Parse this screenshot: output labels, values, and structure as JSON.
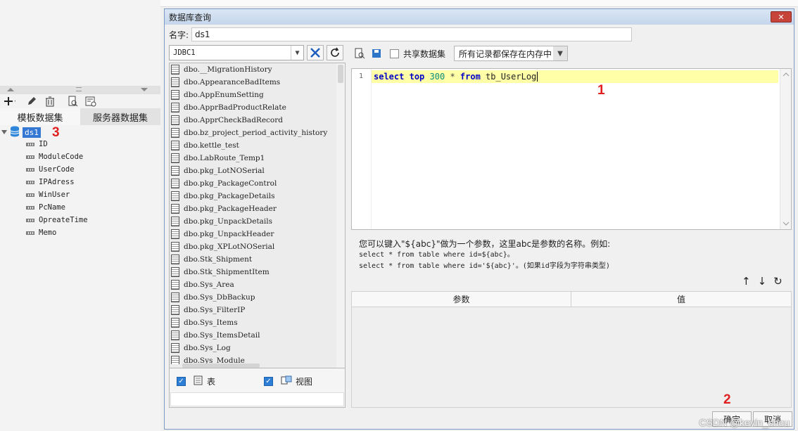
{
  "left_panel": {
    "tabs": [
      "模板数据集",
      "服务器数据集"
    ],
    "dataset": {
      "name": "ds1",
      "marker": "3"
    },
    "fields": [
      "ID",
      "ModuleCode",
      "UserCode",
      "IPAdress",
      "WinUser",
      "PcName",
      "OpreateTime",
      "Memo"
    ],
    "toolbar_icons": [
      "add-icon",
      "edit-icon",
      "delete-icon",
      "preview-icon",
      "field-settings-icon"
    ]
  },
  "dialog": {
    "title": "数据库查询",
    "close_label": "✕",
    "name_label": "名字:",
    "name_value": "ds1",
    "connection": "JDBC1",
    "tables": [
      "dbo.__MigrationHistory",
      "dbo.AppearanceBadItems",
      "dbo.AppEnumSetting",
      "dbo.ApprBadProductRelate",
      "dbo.ApprCheckBadRecord",
      "dbo.bz_project_period_activity_history",
      "dbo.kettle_test",
      "dbo.LabRoute_Temp1",
      "dbo.pkg_LotNOSerial",
      "dbo.pkg_PackageControl",
      "dbo.pkg_PackageDetails",
      "dbo.pkg_PackageHeader",
      "dbo.pkg_UnpackDetails",
      "dbo.pkg_UnpackHeader",
      "dbo.pkg_XPLotNOSerial",
      "dbo.Stk_Shipment",
      "dbo.Stk_ShipmentItem",
      "dbo.Sys_Area",
      "dbo.Sys_DbBackup",
      "dbo.Sys_FilterIP",
      "dbo.Sys_Items",
      "dbo.Sys_ItemsDetail",
      "dbo.Sys_Log",
      "dbo.Sys_Module"
    ],
    "check_tables": "表",
    "check_views": "视图",
    "shared_dataset_label": "共享数据集",
    "memory_option": "所有记录都保存在内存中",
    "sql": {
      "line_number": "1",
      "tokens": [
        {
          "t": "select",
          "c": "kw"
        },
        {
          "t": " ",
          "c": ""
        },
        {
          "t": "top",
          "c": "kw"
        },
        {
          "t": " ",
          "c": ""
        },
        {
          "t": "300",
          "c": "num"
        },
        {
          "t": " ",
          "c": ""
        },
        {
          "t": "*",
          "c": "op"
        },
        {
          "t": " ",
          "c": ""
        },
        {
          "t": "from",
          "c": "kw"
        },
        {
          "t": " tb_UserLog",
          "c": ""
        }
      ],
      "marker": "1"
    },
    "hint": {
      "line1": "您可以键入\"${abc}\"做为一个参数，这里abc是参数的名称。例如:",
      "line2": "select * from table where id=${abc}。",
      "line3": "select * from table where id='${abc}'。(如果id字段为字符串类型)"
    },
    "param_columns": [
      "参数",
      "值"
    ],
    "ok_label": "确定",
    "ok_marker": "2",
    "cancel_label": "取消"
  },
  "watermark": "CSDN @kevin_chou"
}
